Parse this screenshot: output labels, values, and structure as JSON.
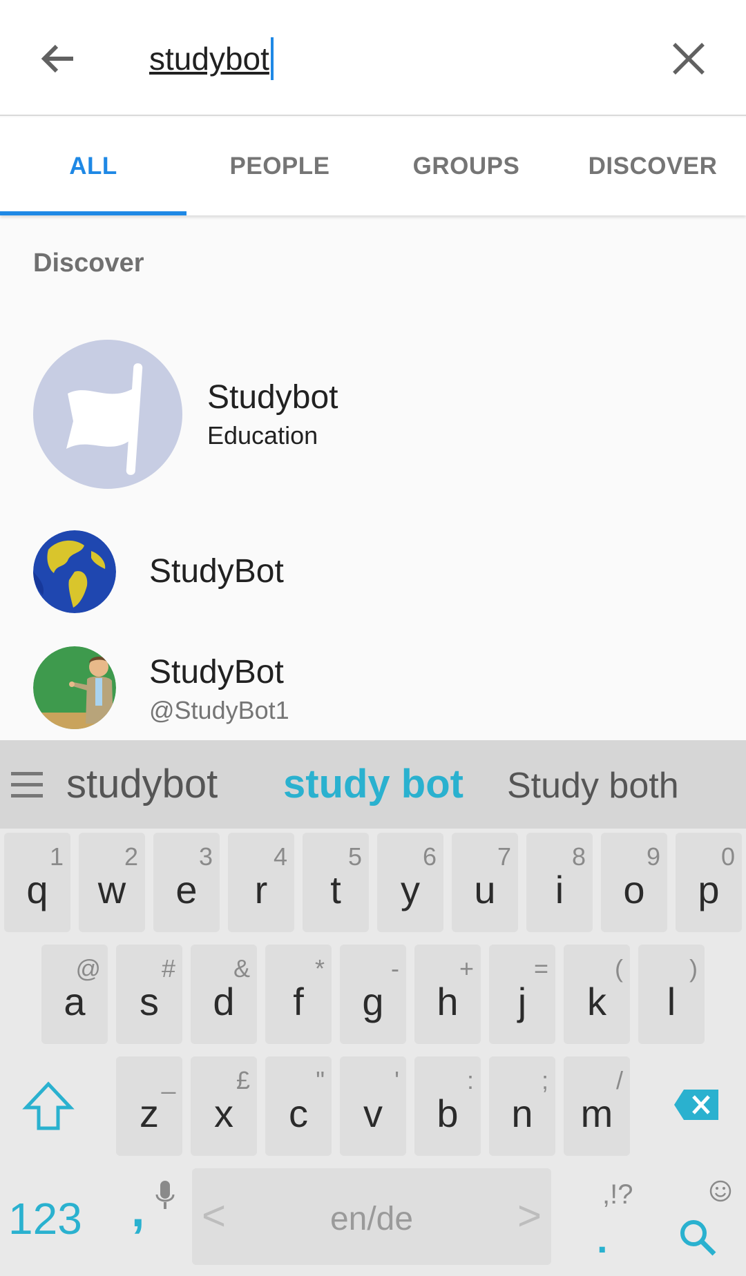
{
  "search": {
    "query": "studybot"
  },
  "tabs": [
    {
      "label": "ALL",
      "active": true
    },
    {
      "label": "PEOPLE",
      "active": false
    },
    {
      "label": "GROUPS",
      "active": false
    },
    {
      "label": "DISCOVER",
      "active": false
    }
  ],
  "discover": {
    "section_title": "Discover",
    "results": [
      {
        "name": "Studybot",
        "subtitle": "Education",
        "avatar": "flag-icon"
      },
      {
        "name": "StudyBot",
        "avatar": "globe-avatar"
      },
      {
        "name": "StudyBot",
        "subtitle": "@StudyBot1",
        "avatar": "teacher-avatar"
      }
    ]
  },
  "keyboard": {
    "suggestions": [
      "studybot",
      "study bot",
      "Study both"
    ],
    "row1": [
      {
        "main": "q",
        "hint": "1"
      },
      {
        "main": "w",
        "hint": "2"
      },
      {
        "main": "e",
        "hint": "3"
      },
      {
        "main": "r",
        "hint": "4"
      },
      {
        "main": "t",
        "hint": "5"
      },
      {
        "main": "y",
        "hint": "6"
      },
      {
        "main": "u",
        "hint": "7"
      },
      {
        "main": "i",
        "hint": "8"
      },
      {
        "main": "o",
        "hint": "9"
      },
      {
        "main": "p",
        "hint": "0"
      }
    ],
    "row2": [
      {
        "main": "a",
        "hint": "@"
      },
      {
        "main": "s",
        "hint": "#"
      },
      {
        "main": "d",
        "hint": "&"
      },
      {
        "main": "f",
        "hint": "*"
      },
      {
        "main": "g",
        "hint": "-"
      },
      {
        "main": "h",
        "hint": "+"
      },
      {
        "main": "j",
        "hint": "="
      },
      {
        "main": "k",
        "hint": "("
      },
      {
        "main": "l",
        "hint": ")"
      }
    ],
    "row3": [
      {
        "main": "z",
        "hint": "_"
      },
      {
        "main": "x",
        "hint": "£"
      },
      {
        "main": "c",
        "hint": "\""
      },
      {
        "main": "v",
        "hint": "'"
      },
      {
        "main": "b",
        "hint": ":"
      },
      {
        "main": "n",
        "hint": ";"
      },
      {
        "main": "m",
        "hint": "/"
      }
    ],
    "numbers_label": "123",
    "comma_label": ",",
    "space_label": "en/de",
    "space_left_arrow": "<",
    "space_right_arrow": ">",
    "punct_label": ",!?",
    "period_label": "."
  },
  "colors": {
    "accent": "#1e88e5",
    "keyboard_accent": "#2ab1cf",
    "avatar_bg": "#c7cde3"
  }
}
